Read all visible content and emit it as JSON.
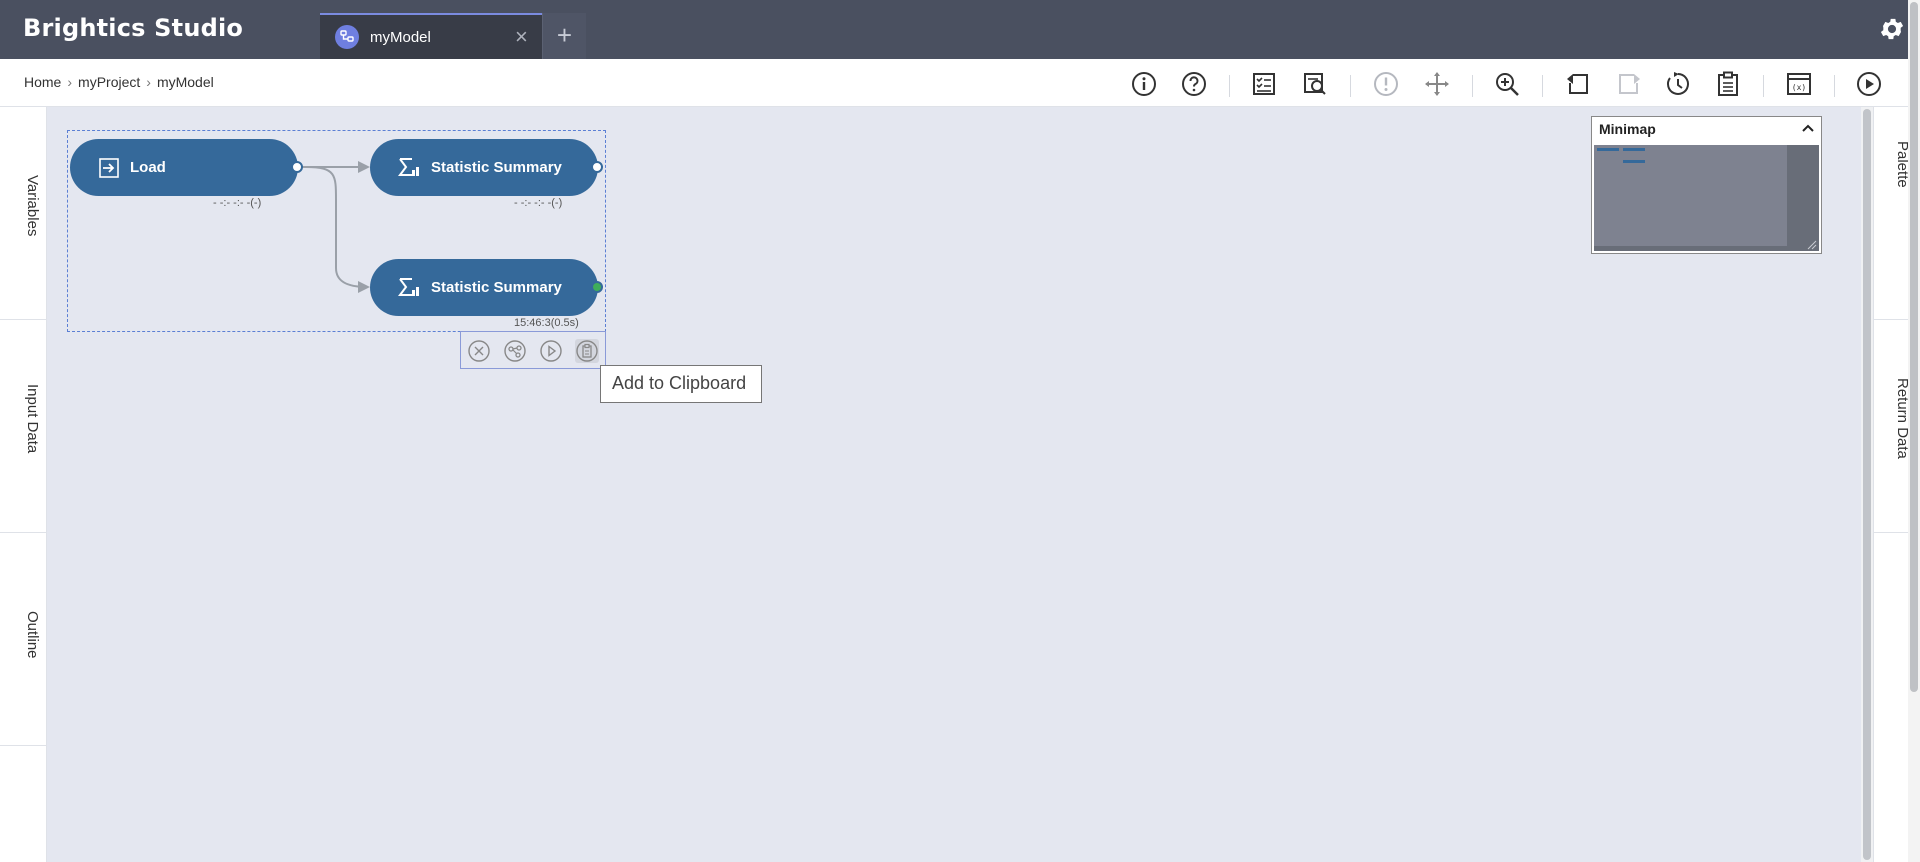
{
  "app": {
    "title": "Brightics Studio"
  },
  "tabs": [
    {
      "label": "myModel",
      "active": true
    }
  ],
  "breadcrumb": [
    "Home",
    "myProject",
    "myModel"
  ],
  "toolbar": {
    "icons": [
      "info-icon",
      "help-icon",
      "report-icon",
      "preview-icon",
      "validate-icon",
      "move-icon",
      "zoom-icon",
      "undo-icon",
      "redo-icon",
      "history-icon",
      "clipboard-icon",
      "layout-icon",
      "run-icon"
    ]
  },
  "left_panel": [
    "Variables",
    "Input Data",
    "Outline"
  ],
  "right_panel": [
    "Palette",
    "Return Data"
  ],
  "nodes": [
    {
      "label": "Load",
      "status": "- -:- -:- -(-)"
    },
    {
      "label": "Statistic Summary",
      "status": "- -:- -:- -(-)"
    },
    {
      "label": "Statistic Summary",
      "status": "15:46:3(0.5s)"
    }
  ],
  "tooltip": "Add to Clipboard",
  "minimap": {
    "title": "Minimap"
  },
  "colors": {
    "topbar": "#4a5060",
    "node": "#35699a",
    "canvas": "#e4e7f0",
    "accent": "#6f7fe0",
    "success_port": "#3fae5a"
  }
}
